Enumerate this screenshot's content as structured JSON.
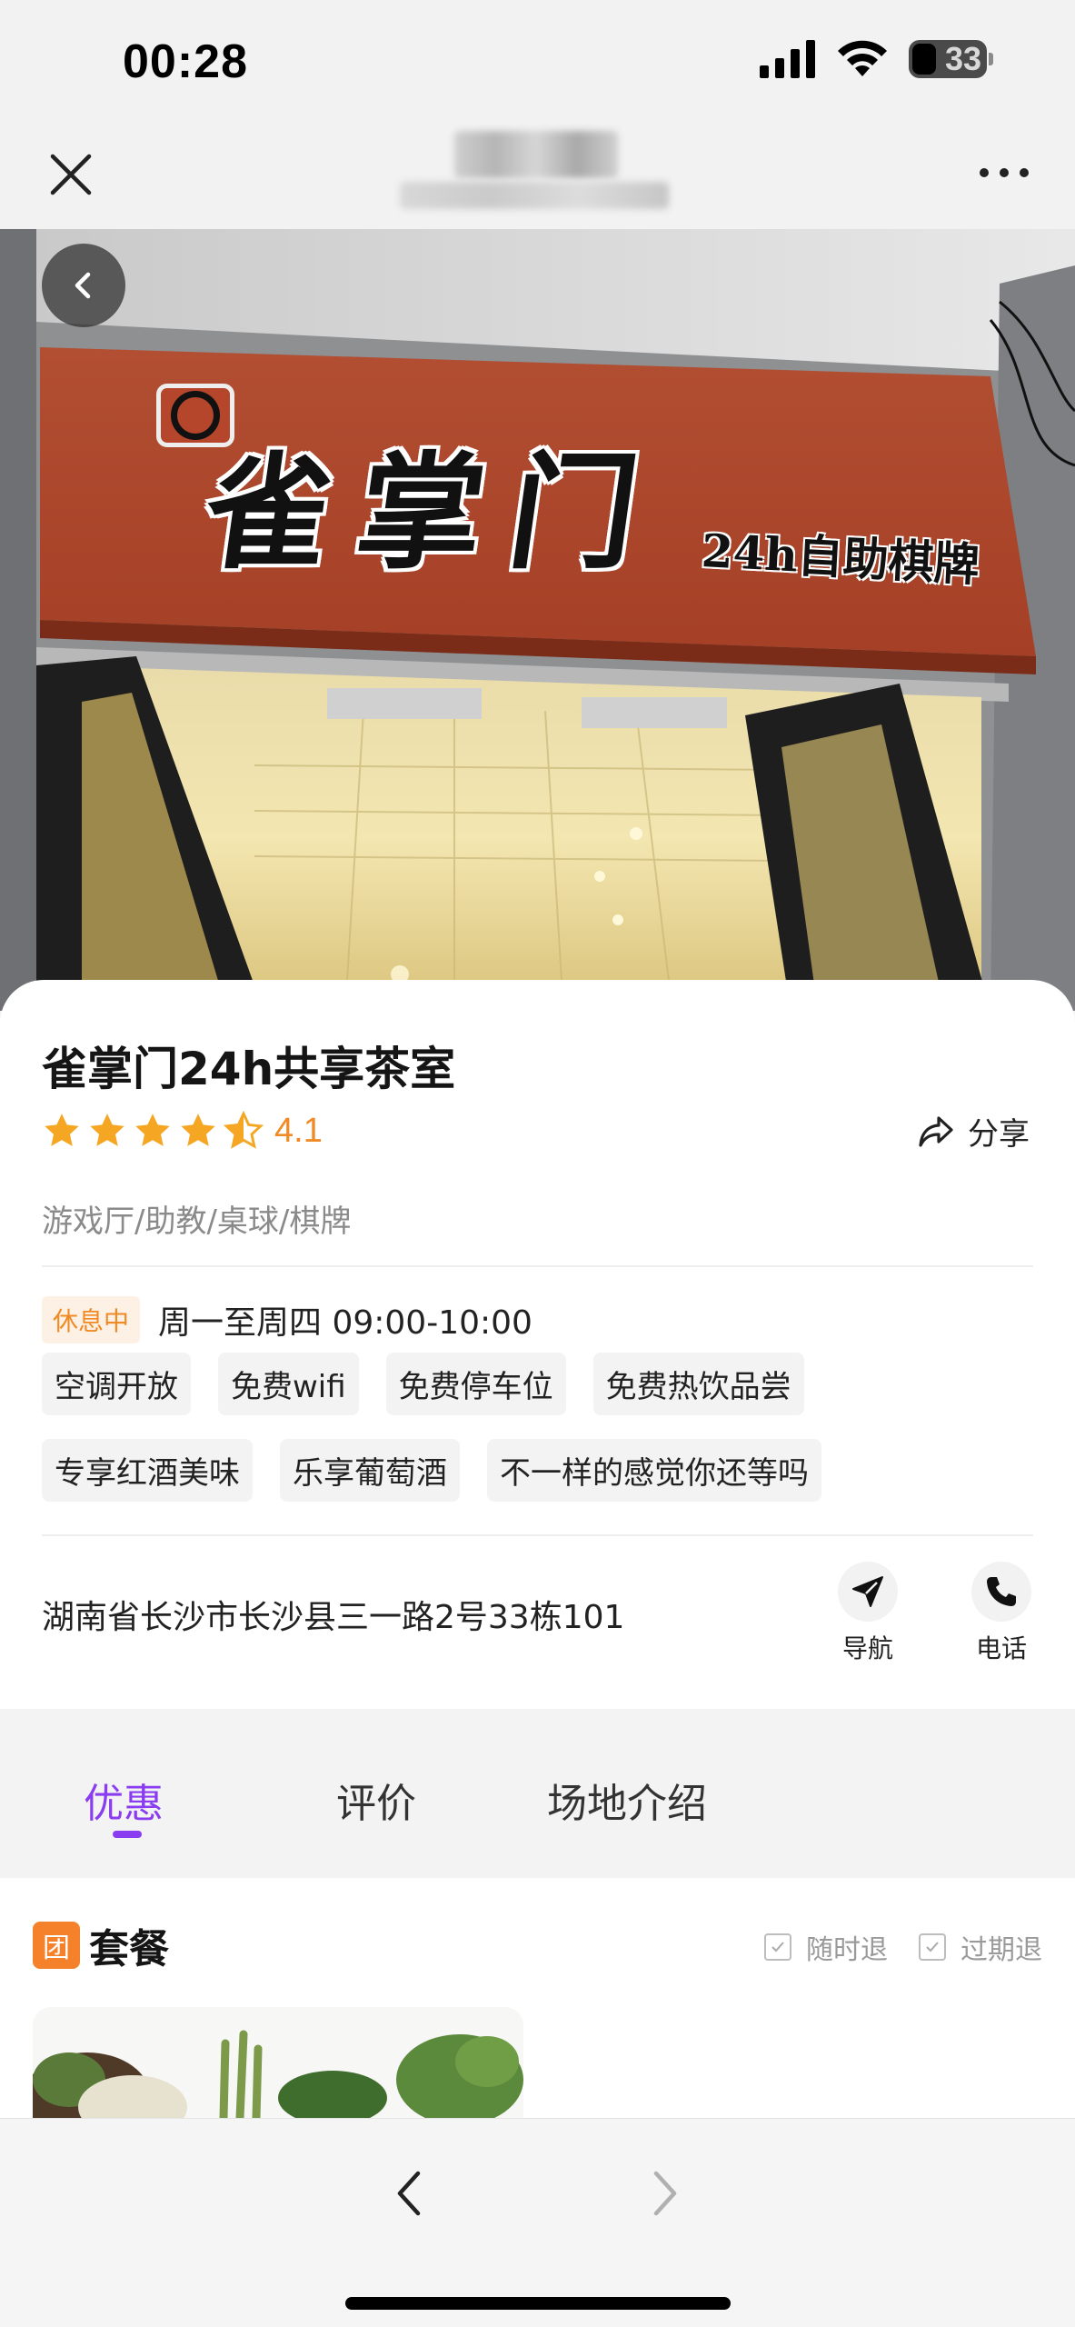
{
  "status_bar": {
    "time": "00:28",
    "battery": "33",
    "icons": [
      "signal-icon",
      "wifi-icon",
      "battery-icon"
    ]
  },
  "nav": {
    "close_icon": "close-icon",
    "more_icon": "more-icon"
  },
  "hero": {
    "sign_main": "雀掌门",
    "sign_sub": "24h自助棋牌",
    "back_icon": "chevron-left-icon"
  },
  "shop": {
    "name": "雀掌门24h共享茶室",
    "rating": "4.1",
    "rating_value": 4.5,
    "stars_max": 5,
    "share_label": "分享",
    "categories": "游戏厅/助教/桌球/棋牌",
    "status_badge": "休息中",
    "hours": "周一至周四 09:00-10:00",
    "tags": [
      "空调开放",
      "免费wifi",
      "免费停车位",
      "免费热饮品尝",
      "专享红酒美味",
      "乐享葡萄酒",
      "不一样的感觉你还等吗"
    ],
    "address": "湖南省长沙市长沙县三一路2号33栋101",
    "actions": [
      {
        "label": "导航",
        "icon": "navigation-icon"
      },
      {
        "label": "电话",
        "icon": "phone-icon"
      }
    ]
  },
  "tabs": [
    {
      "label": "优惠",
      "active": true
    },
    {
      "label": "评价",
      "active": false
    },
    {
      "label": "场地介绍",
      "active": false
    }
  ],
  "package": {
    "badge": "团",
    "title": "套餐",
    "policies": [
      "随时退",
      "过期退"
    ]
  },
  "colors": {
    "accent": "#8a3cf0",
    "star": "#f5a623",
    "status_orange": "#f08a24",
    "package_orange": "#f5822a"
  }
}
